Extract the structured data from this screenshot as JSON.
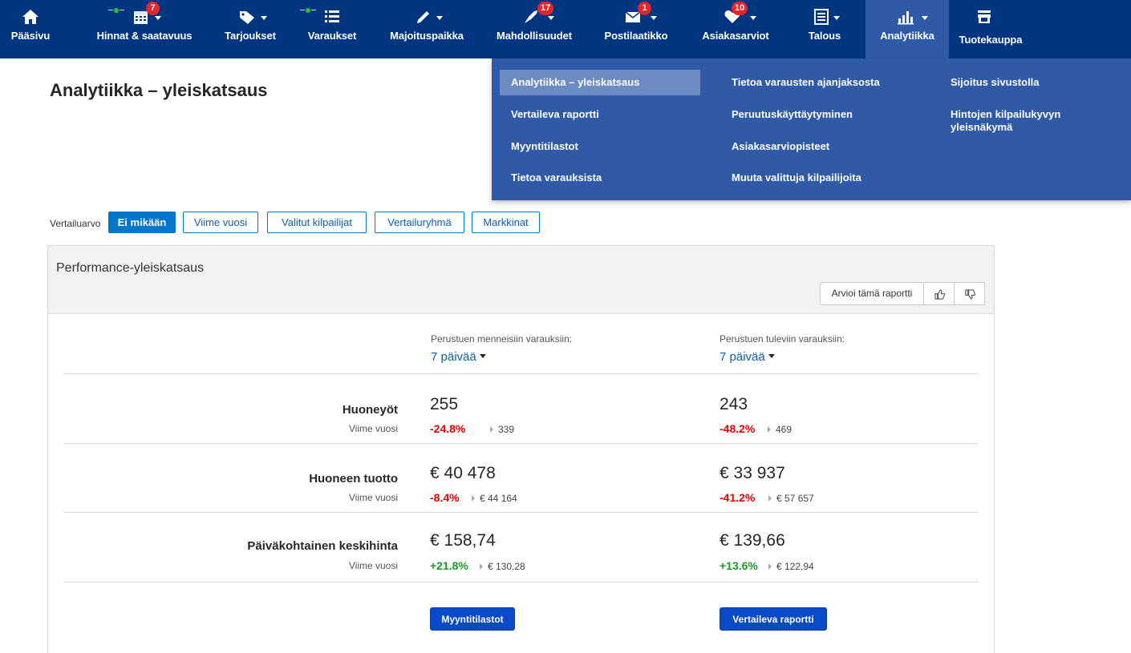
{
  "nav": {
    "items": [
      {
        "label": "Pääsivu",
        "icon": "home-icon"
      },
      {
        "label": "Hinnat & saatavuus",
        "icon": "calendar-icon",
        "badge": "7"
      },
      {
        "label": "Tarjoukset",
        "icon": "tag-icon"
      },
      {
        "label": "Varaukset",
        "icon": "list-icon"
      },
      {
        "label": "Majoituspaikka",
        "icon": "pencil-icon"
      },
      {
        "label": "Mahdollisuudet",
        "icon": "rocket-icon",
        "badge": "17"
      },
      {
        "label": "Postilaatikko",
        "icon": "mail-icon",
        "badge": "1"
      },
      {
        "label": "Asiakasarviot",
        "icon": "heart-icon",
        "badge": "10"
      },
      {
        "label": "Talous",
        "icon": "ledger-icon"
      },
      {
        "label": "Analytiikka",
        "icon": "bar-chart-icon",
        "active": true
      },
      {
        "label": "Tuotekauppa",
        "icon": "store-icon"
      }
    ]
  },
  "dropdown": {
    "col1": [
      "Analytiikka – yleiskatsaus",
      "Vertaileva raportti",
      "Myyntitilastot",
      "Tietoa varauksista"
    ],
    "col2": [
      "Tietoa varausten ajanjaksosta",
      "Peruutuskäyttäytyminen",
      "Asiakasarviopisteet",
      "Muuta valittuja kilpailijoita"
    ],
    "col3": [
      "Sijoitus sivustolla",
      "Hintojen kilpailukyvyn yleisnäkymä"
    ]
  },
  "page": {
    "title": "Analytiikka – yleiskatsaus"
  },
  "compare": {
    "label": "Vertailuarvo",
    "options": [
      "Ei mikään",
      "Viime vuosi",
      "Valitut kilpailijat",
      "Vertailuryhmä",
      "Markkinat"
    ],
    "selected": "Ei mikään"
  },
  "panel": {
    "title": "Performance-yleiskatsaus",
    "rate_label": "Arvioi tämä raportti",
    "past_caption": "Perustuen menneisiin varauksiin:",
    "future_caption": "Perustuen tuleviin varauksiin:",
    "past_period": "7 päivää",
    "future_period": "7 päivää",
    "compare_sub": "Viime vuosi",
    "metrics": [
      {
        "label": "Huoneyöt",
        "past": {
          "value": "255",
          "delta": "-24.8%",
          "prev": "339"
        },
        "future": {
          "value": "243",
          "delta": "-48.2%",
          "prev": "469"
        }
      },
      {
        "label": "Huoneen tuotto",
        "past": {
          "value": "€ 40 478",
          "delta": "-8.4%",
          "prev": "€ 44 164"
        },
        "future": {
          "value": "€ 33 937",
          "delta": "-41.2%",
          "prev": "€ 57 657"
        }
      },
      {
        "label": "Päiväkohtainen keskihinta",
        "past": {
          "value": "€ 158,74",
          "delta": "+21.8%",
          "prev": "€ 130,28"
        },
        "future": {
          "value": "€ 139,66",
          "delta": "+13.6%",
          "prev": "€ 122,94"
        }
      }
    ],
    "btn_sales": "Myyntitilastot",
    "btn_compare": "Vertaileva raportti"
  },
  "colors": {
    "nav_bg": "#003580",
    "nav_active": "#2e5aa8",
    "badge": "#e4262c",
    "negative": "#e00000",
    "positive": "#1a9a26",
    "primary_button": "#0a49c8"
  }
}
